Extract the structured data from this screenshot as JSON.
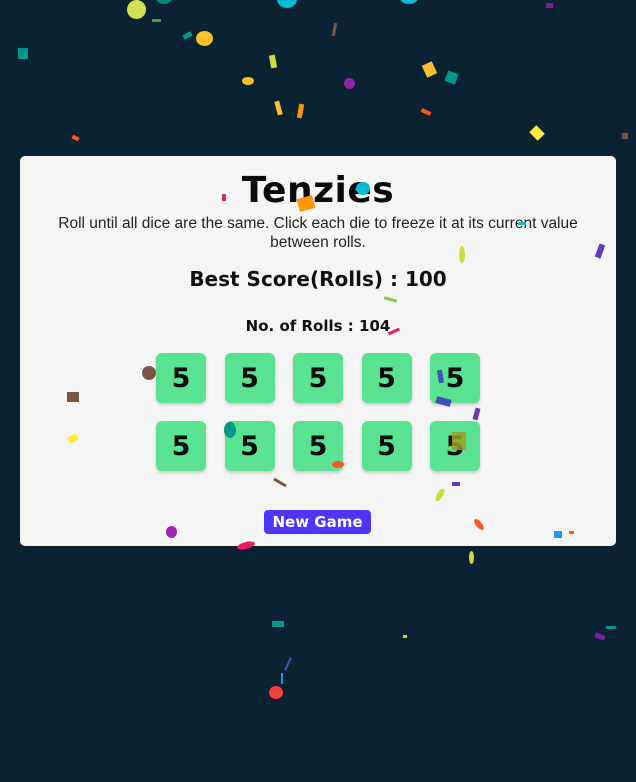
{
  "app": {
    "title": "Tenzies",
    "instructions": "Roll until all dice are the same. Click each die to freeze it at its current value between rolls.",
    "best_score_label": "Best Score(Rolls) : 100",
    "rolls_label": "No. of Rolls : 104",
    "new_game_label": "New Game"
  },
  "dice": [
    "5",
    "5",
    "5",
    "5",
    "5",
    "5",
    "5",
    "5",
    "5",
    "5"
  ],
  "colors": {
    "background": "#0b2233",
    "card": "#f5f5f5",
    "die": "#59e391",
    "button": "#5035ff"
  }
}
